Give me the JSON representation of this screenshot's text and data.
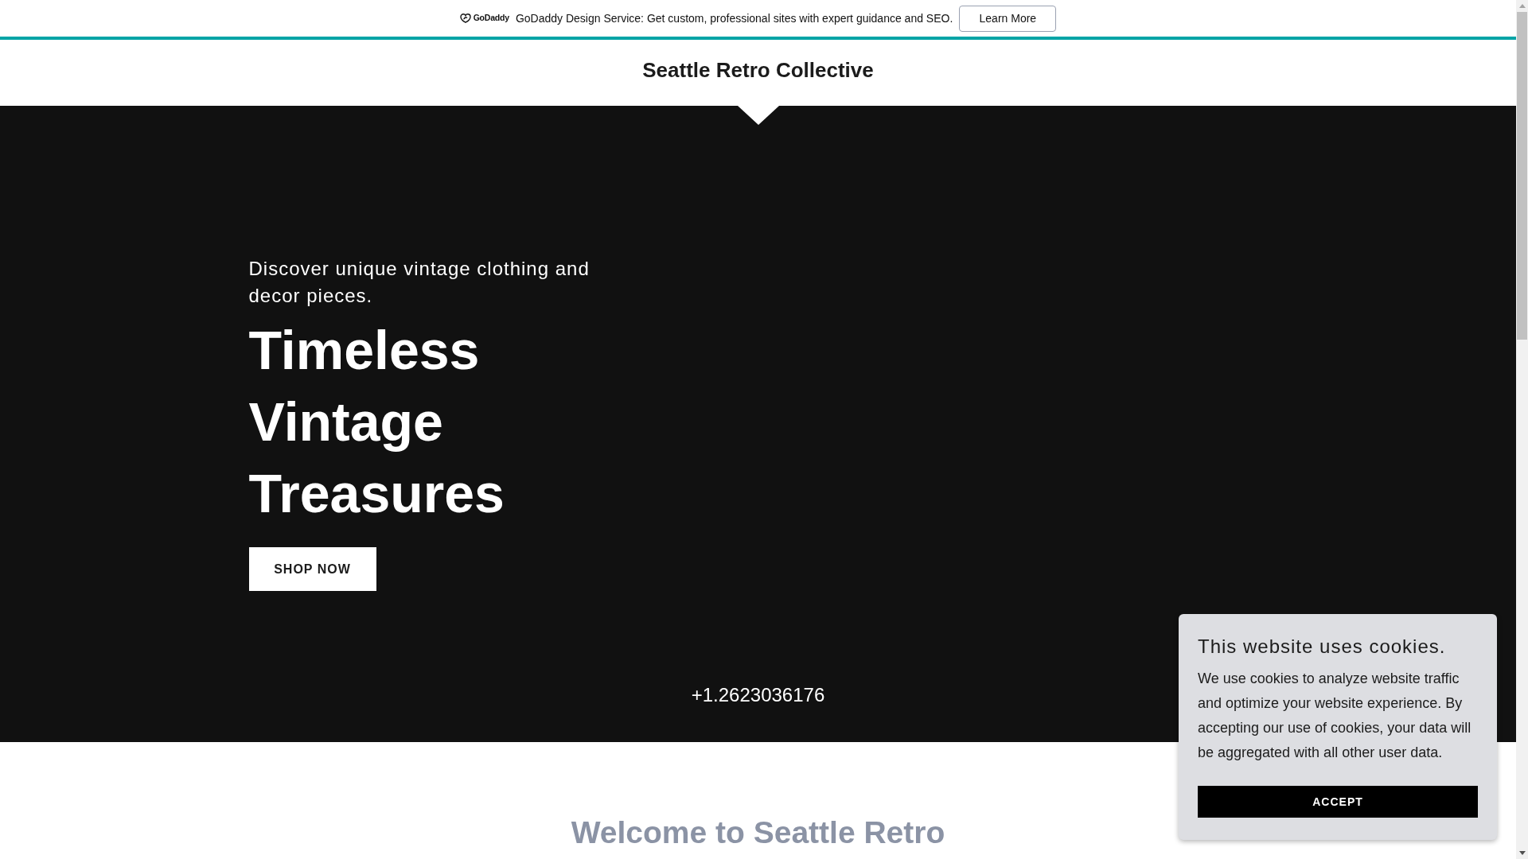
{
  "promo_banner": {
    "logo_text": "GoDaddy",
    "message": "GoDaddy Design Service: Get custom, professional sites with expert guidance and SEO.",
    "button": "Learn More"
  },
  "header": {
    "site_title": "Seattle Retro Collective"
  },
  "hero": {
    "tagline": "Discover unique vintage clothing and decor pieces.",
    "heading": "Timeless Vintage Treasures",
    "button": "SHOP NOW",
    "phone": "+1.2623036176"
  },
  "welcome": {
    "heading": "Welcome to Seattle Retro"
  },
  "cookie_notice": {
    "title": "This website uses cookies.",
    "body": "We use cookies to analyze website traffic and optimize your website experience. By accepting our use of cookies, your data will be aggregated with all other user data.",
    "button": "ACCEPT"
  }
}
